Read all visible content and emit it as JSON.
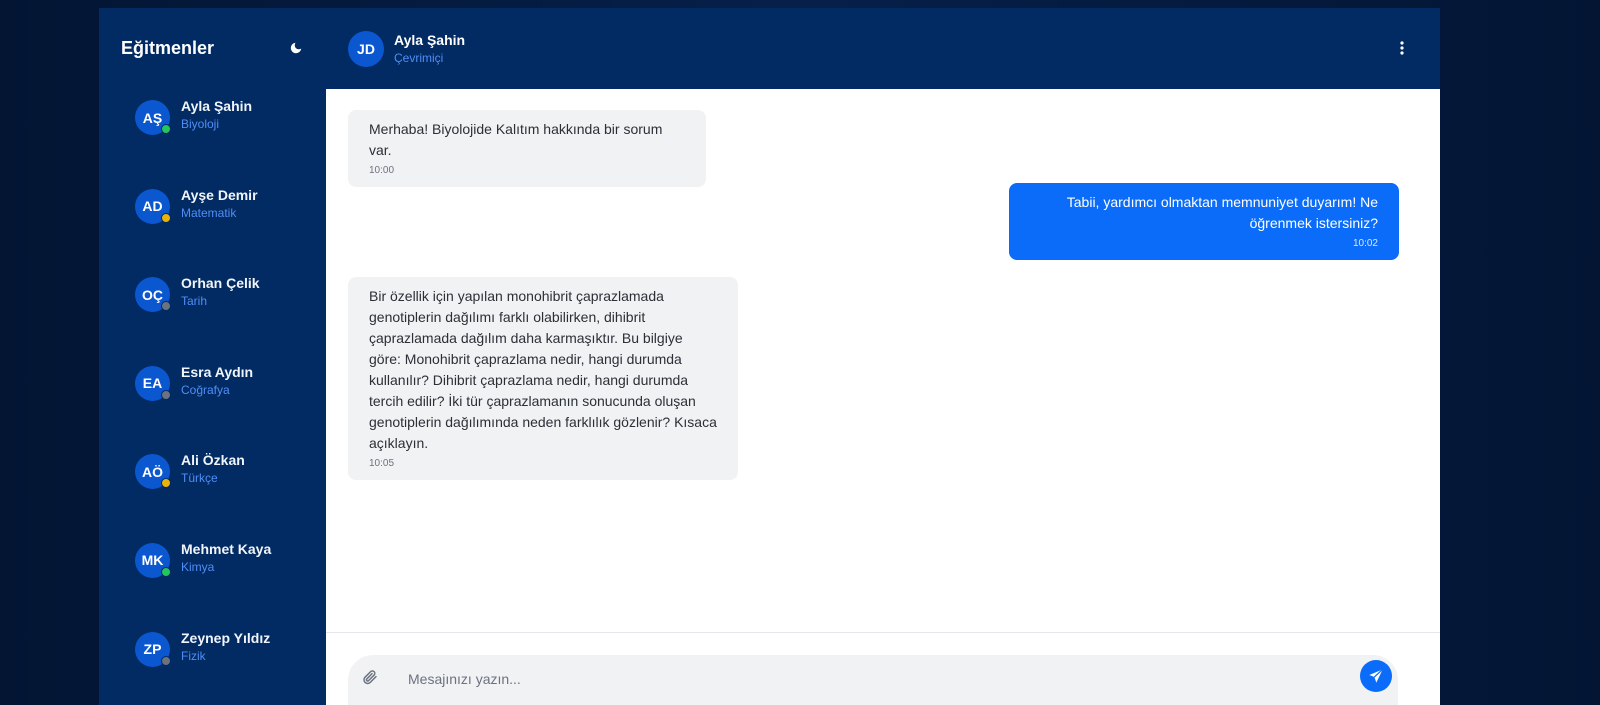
{
  "sidebar": {
    "title": "Eğitmenler",
    "theme_icon": "moon-icon",
    "instructors": [
      {
        "initials": "AŞ",
        "name": "Ayla Şahin",
        "subject": "Biyoloji",
        "status_color": "#22c55e"
      },
      {
        "initials": "AD",
        "name": "Ayşe Demir",
        "subject": "Matematik",
        "status_color": "#eab308"
      },
      {
        "initials": "OÇ",
        "name": "Orhan Çelik",
        "subject": "Tarih",
        "status_color": "#6b7280"
      },
      {
        "initials": "EA",
        "name": "Esra Aydın",
        "subject": "Coğrafya",
        "status_color": "#6b7280"
      },
      {
        "initials": "AÖ",
        "name": "Ali Özkan",
        "subject": "Türkçe",
        "status_color": "#eab308"
      },
      {
        "initials": "MK",
        "name": "Mehmet Kaya",
        "subject": "Kimya",
        "status_color": "#22c55e"
      },
      {
        "initials": "ZP",
        "name": "Zeynep Yıldız",
        "subject": "Fizik",
        "status_color": "#6b7280"
      }
    ]
  },
  "chat_header": {
    "initials": "JD",
    "name": "Ayla Şahin",
    "status": "Çevrimiçi",
    "menu_icon": "more-vertical-icon"
  },
  "messages": [
    {
      "direction": "incoming",
      "text": "Merhaba! Biyolojide Kalıtım hakkında bir sorum var.",
      "time": "10:00"
    },
    {
      "direction": "outgoing",
      "text": "Tabii, yardımcı olmaktan memnuniyet duyarım! Ne öğrenmek istersiniz?",
      "time": "10:02"
    },
    {
      "direction": "incoming",
      "text": "Bir özellik için yapılan monohibrit çaprazlamada genotiplerin dağılımı farklı olabilirken, dihibrit çaprazlamada dağılım daha karmaşıktır. Bu bilgiye göre: Monohibrit çaprazlama nedir, hangi durumda kullanılır? Dihibrit çaprazlama nedir, hangi durumda tercih edilir? İki tür çaprazlamanın sonucunda oluşan genotiplerin dağılımında neden farklılık gözlenir? Kısaca açıklayın.",
      "time": "10:05"
    }
  ],
  "composer": {
    "placeholder": "Mesajınızı yazın...",
    "value": "",
    "attach_icon": "paperclip-icon",
    "send_icon": "send-icon"
  },
  "colors": {
    "background": "#031533",
    "sidebar": "#022a63",
    "accent": "#0a6cf8",
    "avatar": "#0b57d0",
    "subject_text": "#4f8ef7",
    "online": "#22c55e",
    "away": "#eab308",
    "offline": "#6b7280"
  }
}
